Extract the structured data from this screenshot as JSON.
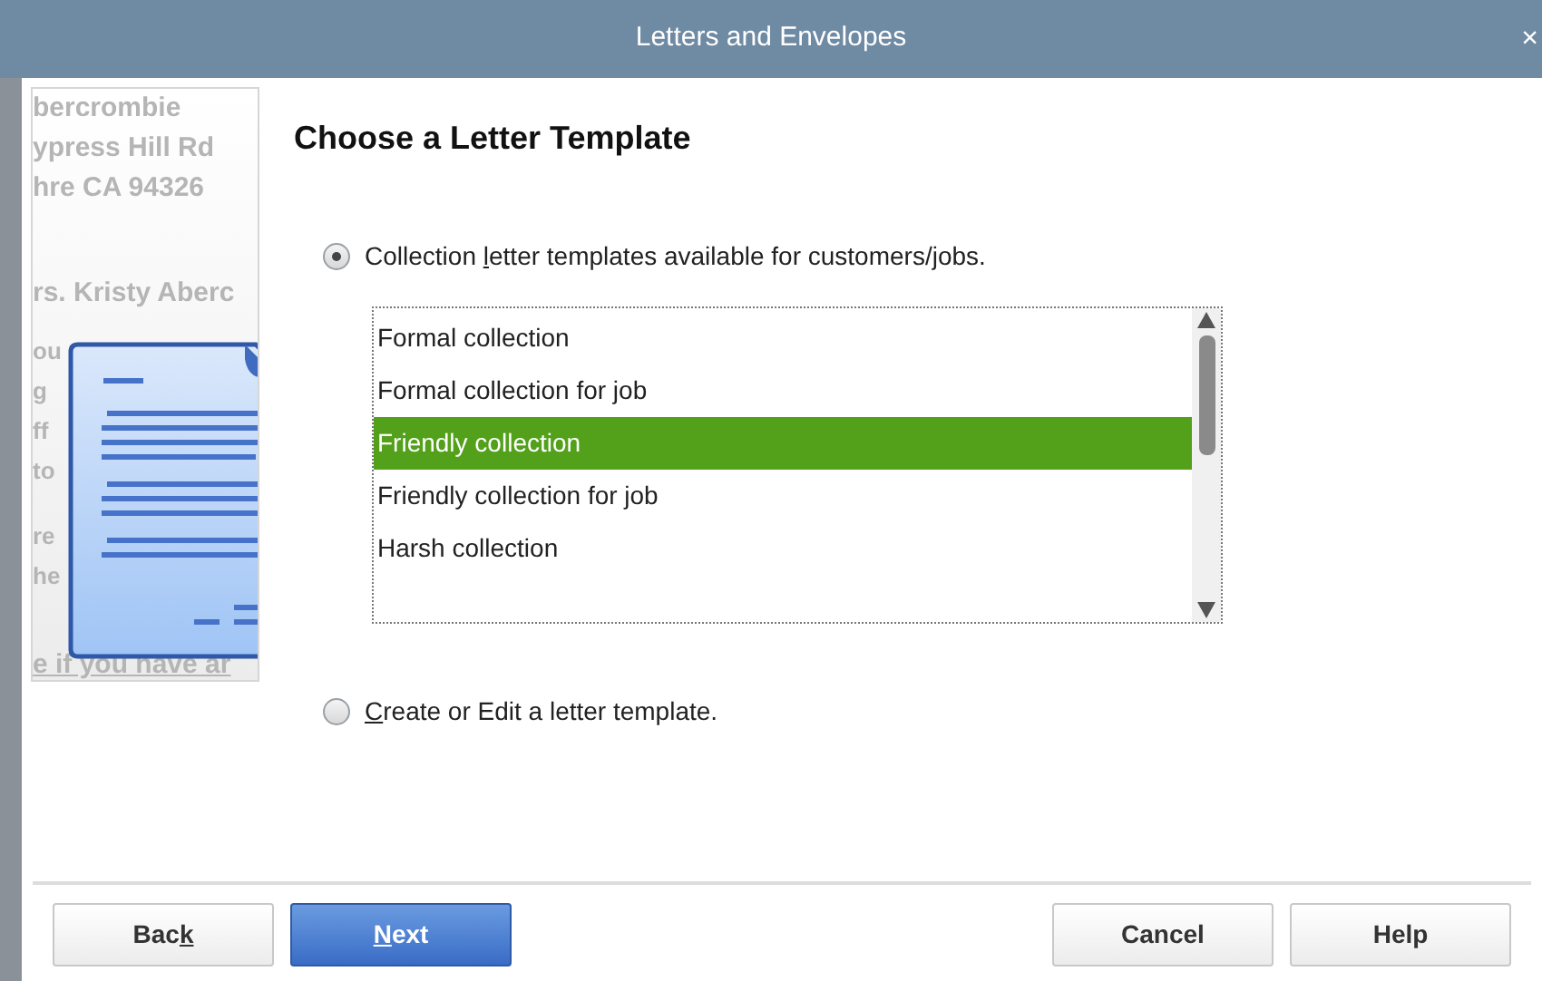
{
  "window": {
    "title": "Letters and Envelopes",
    "close": "×"
  },
  "preview": {
    "lines": [
      "bercrombie",
      "ypress Hill Rd",
      "hre CA 94326",
      "rs. Kristy Aberc"
    ],
    "fragments": [
      "ou",
      "g",
      "ff",
      "to",
      "re",
      "he"
    ],
    "bottom": "e if you have ar"
  },
  "heading": "Choose a Letter Template",
  "options": [
    {
      "selected": true,
      "label": [
        {
          "text": "Collection "
        },
        {
          "text": "l",
          "underlined": true
        },
        {
          "text": "etter templates available for customers/jobs."
        }
      ]
    },
    {
      "selected": false,
      "label": [
        {
          "text": "C",
          "underlined": true
        },
        {
          "text": "reate or Edit a letter template."
        }
      ]
    }
  ],
  "templates": [
    {
      "label": "Formal collection",
      "selected": false
    },
    {
      "label": "Formal collection for job",
      "selected": false
    },
    {
      "label": "Friendly collection",
      "selected": true
    },
    {
      "label": "Friendly collection for job",
      "selected": false
    },
    {
      "label": "Harsh collection",
      "selected": false
    }
  ],
  "buttons": [
    {
      "kind": "plain",
      "label": [
        {
          "text": "Bac"
        },
        {
          "text": "k",
          "underlined": true
        }
      ]
    },
    {
      "kind": "primary",
      "label": [
        {
          "text": "N",
          "underlined": true
        },
        {
          "text": "ext"
        }
      ]
    },
    {
      "kind": "plain",
      "label": [
        {
          "text": "Cancel"
        }
      ]
    },
    {
      "kind": "plain",
      "label": [
        {
          "text": "Help"
        }
      ]
    }
  ]
}
